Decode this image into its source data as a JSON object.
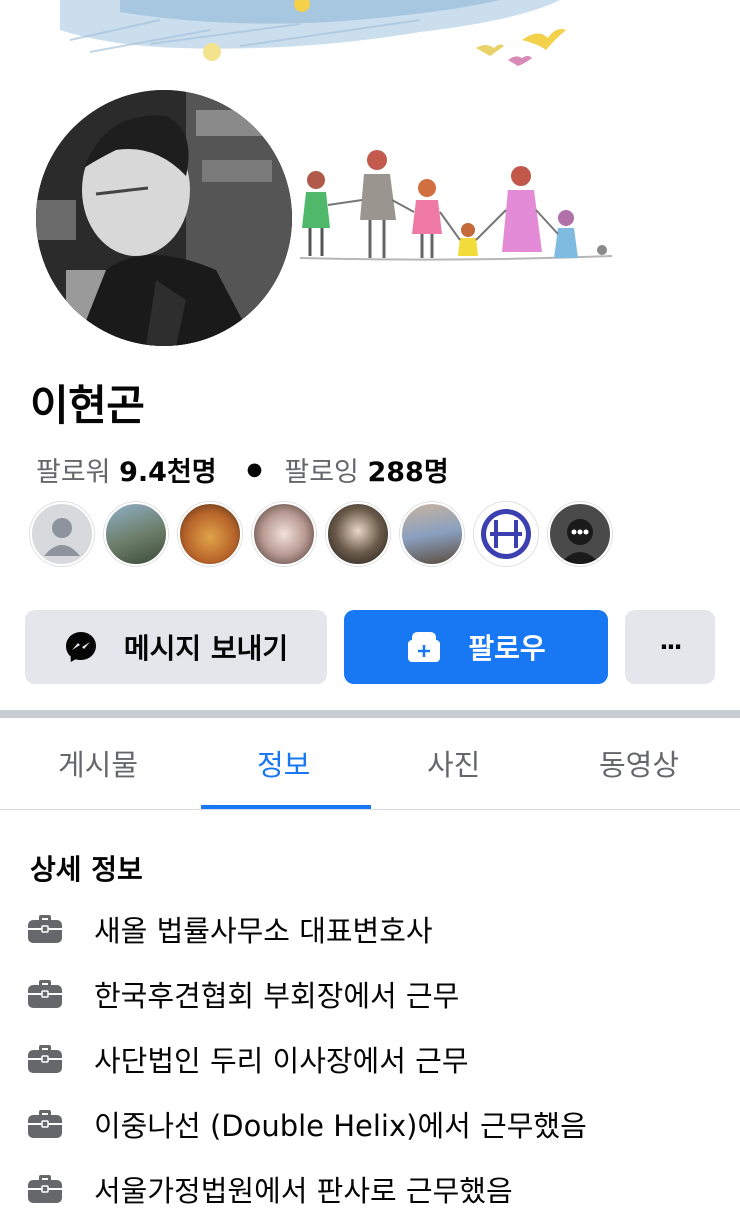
{
  "profile": {
    "name": "이현곤",
    "followers_label": "팔로워",
    "followers_count": "9.4천명",
    "following_label": "팔로잉",
    "following_count": "288명"
  },
  "buttons": {
    "message_label": "메시지 보내기",
    "follow_label": "팔로우",
    "more_label": "···"
  },
  "tabs": [
    {
      "label": "게시물",
      "active": false
    },
    {
      "label": "정보",
      "active": true
    },
    {
      "label": "사진",
      "active": false
    },
    {
      "label": "동영상",
      "active": false
    }
  ],
  "details": {
    "title": "상세 정보",
    "items": [
      {
        "icon": "briefcase-icon",
        "text": "새올 법률사무소 대표변호사"
      },
      {
        "icon": "briefcase-icon",
        "text": "한국후견협회 부회장에서 근무"
      },
      {
        "icon": "briefcase-icon",
        "text": "사단법인 두리 이사장에서 근무"
      },
      {
        "icon": "briefcase-icon",
        "text": "이중나선 (Double Helix)에서 근무했음"
      },
      {
        "icon": "briefcase-icon",
        "text": "서울가정법원에서 판사로 근무했음"
      }
    ]
  },
  "colors": {
    "accent": "#1877f2",
    "secondary_button": "#e4e6eb",
    "muted_text": "#65676b"
  }
}
